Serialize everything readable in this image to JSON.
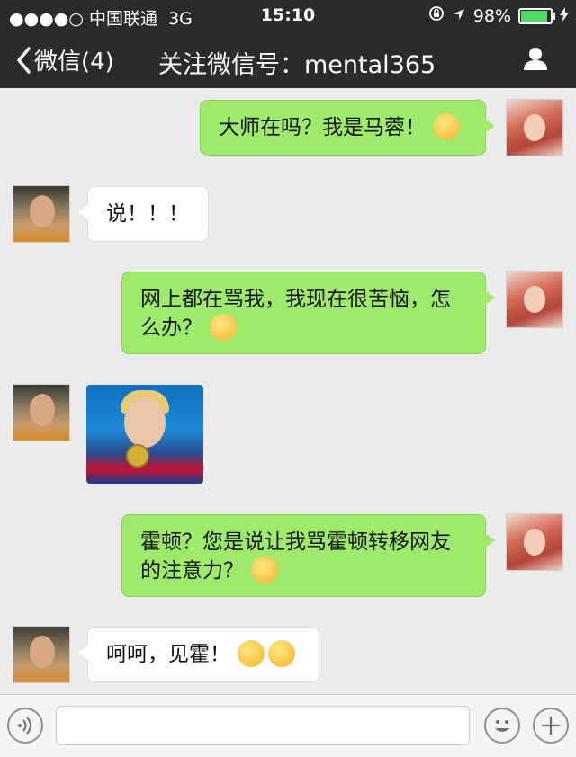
{
  "status_bar": {
    "signal": "●●●●○",
    "carrier": "中国联通",
    "network": "3G",
    "time": "15:10",
    "battery": "98%",
    "battery_level": 0.98
  },
  "nav": {
    "back_label": "微信(4)",
    "title": "关注微信号：mental365"
  },
  "messages": [
    {
      "side": "right",
      "sender": "female-user",
      "text": "大师在吗？我是马蓉！",
      "emoji": "grinning-emoji"
    },
    {
      "side": "left",
      "sender": "master",
      "text": "说！！！"
    },
    {
      "side": "right",
      "sender": "female-user",
      "text": "网上都在骂我，我现在很苦恼，怎么办？",
      "emoji": "laughing-emoji"
    },
    {
      "side": "left",
      "sender": "master",
      "image": "swimmer-photo"
    },
    {
      "side": "right",
      "sender": "female-user",
      "text": "霍顿？您是说让我骂霍顿转移网友的注意力？",
      "emoji": "shocked-emoji"
    },
    {
      "side": "left",
      "sender": "master",
      "text": "呵呵，见霍！",
      "emoji": "smiling-emoji"
    }
  ],
  "colors": {
    "outgoing_bubble": "#9eea6a",
    "incoming_bubble": "#ffffff",
    "chat_background": "#ebebeb",
    "header": "#2b2b2d"
  }
}
